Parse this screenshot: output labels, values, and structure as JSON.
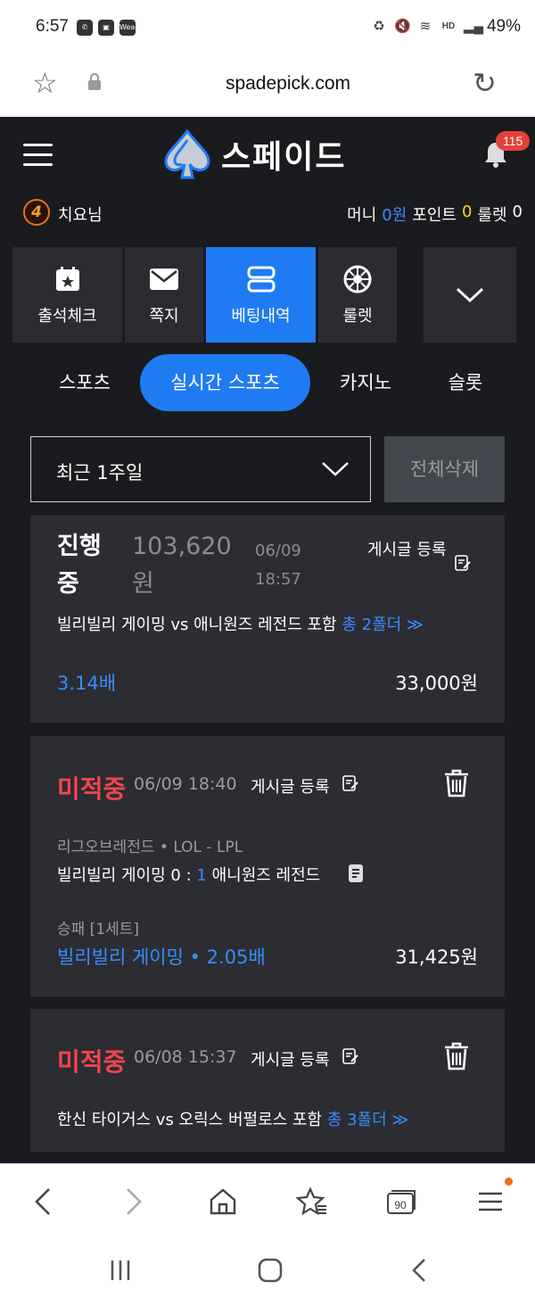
{
  "status_bar": {
    "time": "6:57",
    "battery": "49%",
    "hd_label": "HD",
    "wear_label": "Wear"
  },
  "browser": {
    "url": "spadepick.com"
  },
  "header": {
    "logo_text": "스페이드",
    "notification_count": "115"
  },
  "user": {
    "level": "4",
    "nickname": "치요님",
    "money_label": "머니",
    "money_value": "0원",
    "point_label": "포인트",
    "point_value": "0",
    "roulette_label": "룰렛",
    "roulette_value": "0"
  },
  "menu": {
    "items": [
      {
        "label": "출석체크",
        "icon": "calendar-star-icon"
      },
      {
        "label": "쪽지",
        "icon": "mail-icon"
      },
      {
        "label": "베팅내역",
        "icon": "bet-list-icon",
        "active": true
      },
      {
        "label": "룰렛",
        "icon": "roulette-icon"
      }
    ]
  },
  "tabs": [
    {
      "label": "스포츠"
    },
    {
      "label": "실시간 스포츠",
      "active": true
    },
    {
      "label": "카지노"
    },
    {
      "label": "슬롯"
    }
  ],
  "filter": {
    "selected": "최근 1주일",
    "delete_all_label": "전체삭제"
  },
  "bets": [
    {
      "status": "진행중",
      "amount": "103,620원",
      "datetime": "06/09 18:57",
      "post_label": "게시글 등록",
      "match_text": "빌리빌리 게이밍 vs 애니원즈 레전드 포함",
      "folder_text": "총 2폴더 ≫",
      "odds": "3.14배",
      "stake": "33,000원"
    },
    {
      "status": "미적중",
      "datetime": "06/09 18:40",
      "post_label": "게시글 등록",
      "league": "리그오브레전드  •  LOL - LPL",
      "home": "빌리빌리 게이밍",
      "score_home": "0",
      "score_sep": ":",
      "score_away": "1",
      "away": "애니원즈 레전드",
      "market": "승패 [1세트]",
      "pick": "빌리빌리 게이밍  •  2.05배",
      "stake": "31,425원"
    },
    {
      "status": "미적중",
      "datetime": "06/08 15:37",
      "post_label": "게시글 등록",
      "match_text": "한신 타이거스 vs 오릭스 버펄로스 포함",
      "folder_text": "총 3폴더 ≫"
    }
  ],
  "bottom_nav": {
    "tabs_count": "90"
  },
  "colors": {
    "accent": "#1e7bf2",
    "bg": "#1a1b1e",
    "card": "#2b2d32",
    "lose": "#f0454e",
    "point": "#ffd12a"
  }
}
